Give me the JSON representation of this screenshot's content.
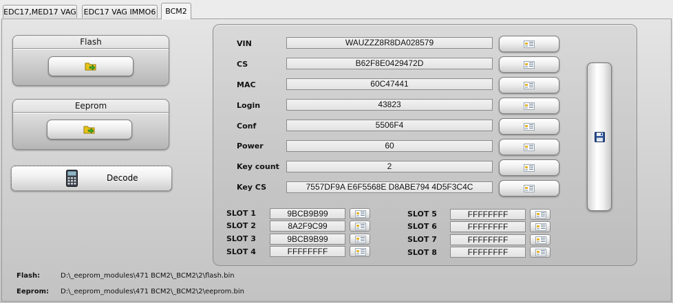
{
  "tabs": [
    {
      "label": "EDC17,MED17 VAG",
      "active": false
    },
    {
      "label": "EDC17 VAG IMMO6",
      "active": false
    },
    {
      "label": "BCM2",
      "active": true
    }
  ],
  "groups": {
    "flash": {
      "title": "Flash",
      "icon": "folder-load-icon"
    },
    "eeprom": {
      "title": "Eeprom",
      "icon": "folder-load-icon"
    }
  },
  "decode": {
    "label": "Decode",
    "icon": "calculator-icon"
  },
  "fields": [
    {
      "label": "VIN",
      "value": "WAUZZZ8R8DA028579"
    },
    {
      "label": "CS",
      "value": "B62F8E0429472D"
    },
    {
      "label": "MAC",
      "value": "60C47441"
    },
    {
      "label": "Login",
      "value": "43823"
    },
    {
      "label": "Conf",
      "value": "5506F4"
    },
    {
      "label": "Power",
      "value": "60"
    },
    {
      "label": "Key count",
      "value": "2"
    },
    {
      "label": "Key CS",
      "value": "7557DF9A E6F5568E D8ABE794 4D5F3C4C"
    }
  ],
  "slots": [
    {
      "label": "SLOT 1",
      "value": "9BCB9B99"
    },
    {
      "label": "SLOT 2",
      "value": "8A2F9C99"
    },
    {
      "label": "SLOT 3",
      "value": "9BCB9B99"
    },
    {
      "label": "SLOT 4",
      "value": "FFFFFFFF"
    },
    {
      "label": "SLOT 5",
      "value": "FFFFFFFF"
    },
    {
      "label": "SLOT 6",
      "value": "FFFFFFFF"
    },
    {
      "label": "SLOT 7",
      "value": "FFFFFFFF"
    },
    {
      "label": "SLOT 8",
      "value": "FFFFFFFF"
    }
  ],
  "icons": {
    "edit": "edit-list-icon",
    "save": "floppy-disk-icon"
  },
  "paths": {
    "flash_label": "Flash:",
    "flash_value": "D:\\_eeprom_modules\\471 BCM2\\_BCM2\\2\\flash.bin",
    "eeprom_label": "Eeprom:",
    "eeprom_value": "D:\\_eeprom_modules\\471 BCM2\\_BCM2\\2\\eeprom.bin"
  },
  "colors": {
    "folder": "#e6c21a",
    "arrow": "#3aa82b",
    "disk": "#2b4f93"
  }
}
